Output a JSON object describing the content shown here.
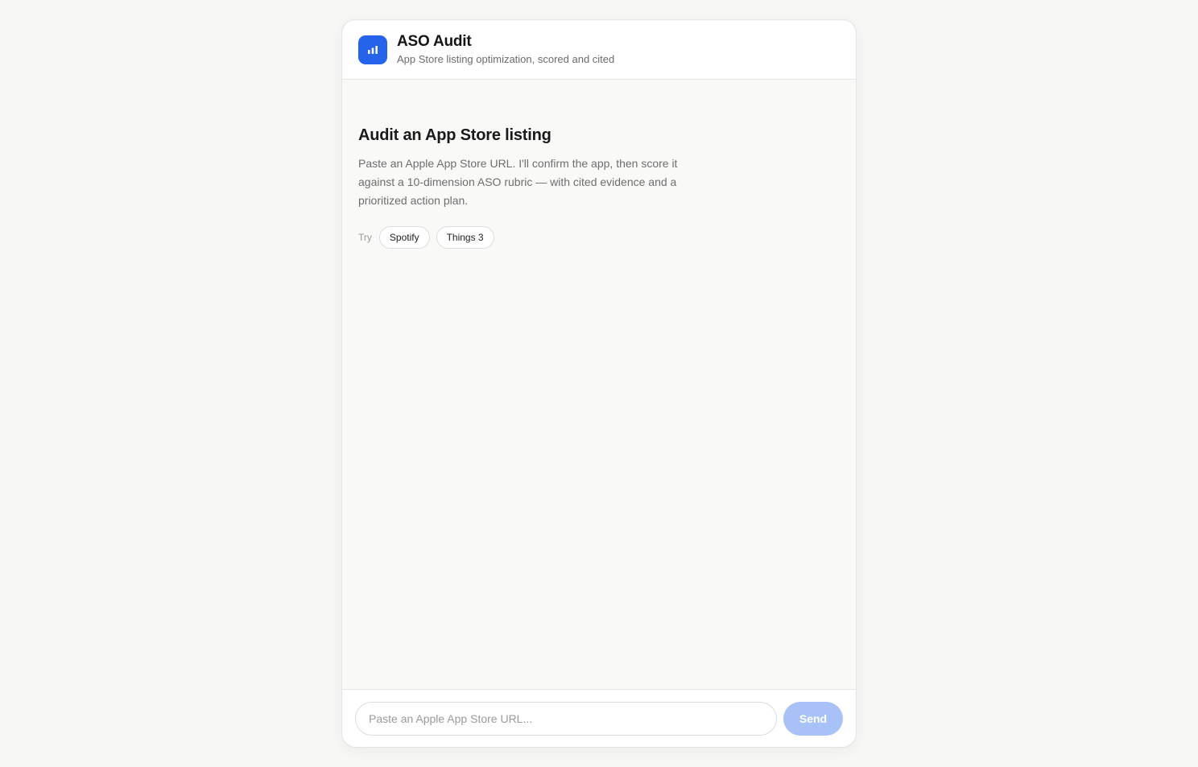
{
  "header": {
    "icon": "bar-chart-icon",
    "title": "ASO Audit",
    "subtitle": "App Store listing optimization, scored and cited"
  },
  "main": {
    "heading": "Audit an App Store listing",
    "description": "Paste an Apple App Store URL. I'll confirm the app, then score it against a 10-dimension ASO rubric — with cited evidence and a prioritized action plan.",
    "try_label": "Try",
    "suggestions": [
      "Spotify",
      "Things 3"
    ]
  },
  "composer": {
    "placeholder": "Paste an Apple App Store URL...",
    "value": "",
    "send_label": "Send"
  },
  "colors": {
    "accent": "#2563eb",
    "send_disabled": "#a8c1f7",
    "background": "#f7f7f6"
  }
}
